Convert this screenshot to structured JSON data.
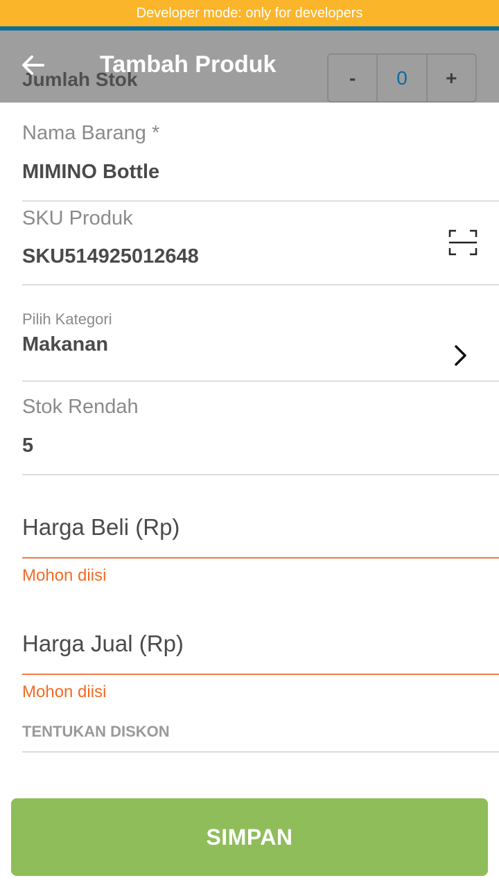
{
  "dev_banner": "Developer mode: only for developers",
  "header": {
    "title": "Tambah Produk",
    "stock_label": "Jumlah Stok",
    "stepper": {
      "minus": "-",
      "value": "0",
      "plus": "+"
    }
  },
  "form": {
    "name_label": "Nama Barang *",
    "name_value": "MIMINO Bottle",
    "sku_label": "SKU Produk",
    "sku_value": "SKU514925012648",
    "category_label": "Pilih Kategori",
    "category_value": "Makanan",
    "low_stock_label": "Stok Rendah",
    "low_stock_value": "5",
    "buy_price_placeholder": "Harga Beli (Rp)",
    "buy_price_error": "Mohon diisi",
    "sell_price_placeholder": "Harga Jual (Rp)",
    "sell_price_error": "Mohon diisi",
    "discount_label": "TENTUKAN DISKON"
  },
  "save_label": "SIMPAN",
  "colors": {
    "banner": "#fbb52a",
    "appbar": "#9e9e9e",
    "error": "#f26b25",
    "save": "#8fbd5a",
    "accent_blue": "#0b6aa2"
  },
  "icons": [
    "arrow-back-icon",
    "barcode-scan-icon",
    "chevron-right-icon"
  ]
}
